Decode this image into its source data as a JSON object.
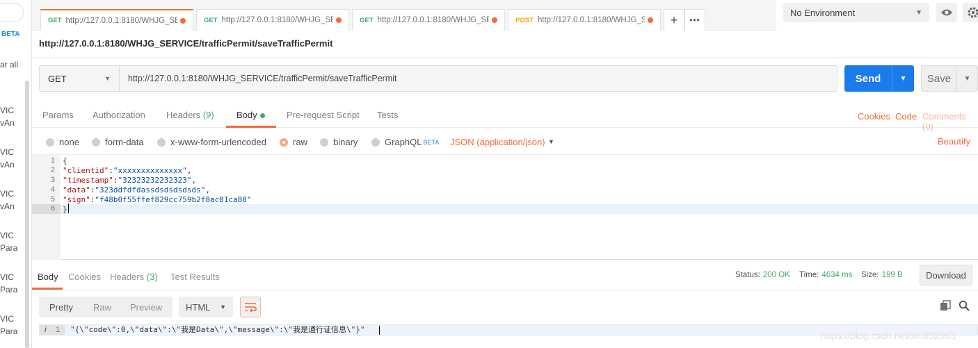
{
  "sidebar": {
    "beta_badge": "BETA",
    "clear_all": "ar all",
    "history": [
      {
        "line1": "VIC",
        "line2": "vAn"
      },
      {
        "line1": "VIC",
        "line2": "vAn"
      },
      {
        "line1": "VIC",
        "line2": "vAn"
      },
      {
        "line1": "VIC",
        "line2": "Para"
      },
      {
        "line1": "VIC",
        "line2": "Para"
      },
      {
        "line1": "VIC",
        "line2": "Para"
      }
    ]
  },
  "tabs": [
    {
      "method": "GET",
      "url": "http://127.0.0.1:8180/WHJG_SE..."
    },
    {
      "method": "GET",
      "url": "http://127.0.0.1:8180/WHJG_SE..."
    },
    {
      "method": "GET",
      "url": "http://127.0.0.1:8180/WHJG_SE..."
    },
    {
      "method": "POST",
      "url": "http://127.0.0.1:8180/WHJG_S..."
    }
  ],
  "tab_actions": {
    "add": "+",
    "more": "•••"
  },
  "environment": {
    "selected": "No Environment"
  },
  "request": {
    "name": "http://127.0.0.1:8180/WHJG_SERVICE/trafficPermit/saveTrafficPermit",
    "method": "GET",
    "url": "http://127.0.0.1:8180/WHJG_SERVICE/trafficPermit/saveTrafficPermit",
    "send_label": "Send",
    "save_label": "Save"
  },
  "request_tabs": {
    "params": "Params",
    "authorization": "Authorization",
    "headers": "Headers",
    "headers_count": "(9)",
    "body": "Body",
    "prerequest": "Pre-request Script",
    "tests": "Tests",
    "cookies": "Cookies",
    "code": "Code",
    "comments": "Comments (0)"
  },
  "body_types": {
    "none": "none",
    "form_data": "form-data",
    "urlencoded": "x-www-form-urlencoded",
    "raw": "raw",
    "binary": "binary",
    "graphql": "GraphQL",
    "graphql_badge": "BETA",
    "content_type": "JSON (application/json)",
    "beautify": "Beautify",
    "selected": "raw"
  },
  "editor": {
    "line_numbers": [
      "1",
      "2",
      "3",
      "4",
      "5",
      "6"
    ],
    "lines": [
      {
        "key": "",
        "value": "",
        "raw": "{"
      },
      {
        "key": "\"clientid\"",
        "value": "\"xxxxxxxxxxxxxx\"",
        "raw": ""
      },
      {
        "key": "\"timestamp\"",
        "value": "\"32323232232323\"",
        "raw": ""
      },
      {
        "key": "\"data\"",
        "value": "\"323ddfdfdassdsdsdsdsds\"",
        "raw": ""
      },
      {
        "key": "\"sign\"",
        "value": "\"f48b0f55ffef829cc759b2f8ac01ca88\"",
        "raw": ""
      },
      {
        "key": "",
        "value": "",
        "raw": "}"
      }
    ]
  },
  "response": {
    "tabs": {
      "body": "Body",
      "cookies": "Cookies",
      "headers": "Headers",
      "headers_count": "(3)",
      "test_results": "Test Results"
    },
    "status_label": "Status:",
    "status_value": "200 OK",
    "time_label": "Time:",
    "time_value": "4634 ms",
    "size_label": "Size:",
    "size_value": "199 B",
    "download": "Download",
    "views": {
      "pretty": "Pretty",
      "raw": "Raw",
      "preview": "Preview"
    },
    "format": "HTML",
    "line_number": "1",
    "body_text": "\"{\\\"code\\\":0,\\\"data\\\":\\\"我是Data\\\",\\\"message\\\":\\\"我是通行证信息\\\"}\""
  },
  "watermark": "https://blog.csdn.net/xhl852963"
}
